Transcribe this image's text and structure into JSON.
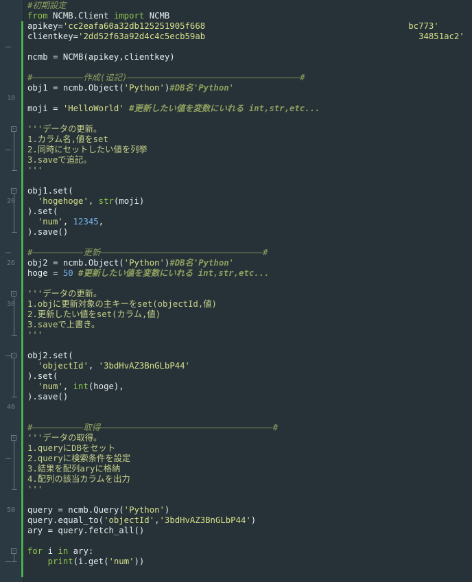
{
  "gutter": {
    "line_numbers": [
      {
        "label": "10",
        "row": 9
      },
      {
        "label": "20",
        "row": 19
      },
      {
        "label": "26",
        "row": 25
      },
      {
        "label": "30",
        "row": 29
      },
      {
        "label": "40",
        "row": 39
      },
      {
        "label": "50",
        "row": 49
      }
    ]
  },
  "code": [
    [
      {
        "t": "#初期設定",
        "c": "c"
      }
    ],
    [
      {
        "t": "from",
        "c": "k"
      },
      {
        "t": " NCMB.Client "
      },
      {
        "t": "import",
        "c": "k"
      },
      {
        "t": " NCMB"
      }
    ],
    [
      {
        "t": "apikey="
      },
      {
        "t": "'cc2eafa60a32db125251905f668",
        "c": "s"
      },
      {
        "t": "                                        ",
        "c": ""
      },
      {
        "t": "bc773'",
        "c": "s"
      }
    ],
    [
      {
        "t": "clientkey="
      },
      {
        "t": "'2dd52f63a92d4c4c5ecb59ab",
        "c": "s"
      },
      {
        "t": "                                          ",
        "c": ""
      },
      {
        "t": "34851ac2'",
        "c": "s"
      }
    ],
    [],
    [
      {
        "t": "ncmb = NCMB(apikey,clientkey)"
      }
    ],
    [],
    [
      {
        "t": "#――――――――――作成(追記)――――――――――――――――――――――――――――――――――#",
        "c": "c"
      }
    ],
    [
      {
        "t": "obj1 = ncmb.Object("
      },
      {
        "t": "'Python'",
        "c": "s"
      },
      {
        "t": ")"
      },
      {
        "t": "#DB名'Python'",
        "c": "cb"
      }
    ],
    [],
    [
      {
        "t": "moji = "
      },
      {
        "t": "'HelloWorld'",
        "c": "s"
      },
      {
        "t": " "
      },
      {
        "t": "#更新したい値を変数にいれる int,str,etc...",
        "c": "cb"
      }
    ],
    [],
    [
      {
        "t": "'''データの更新。",
        "c": "d"
      }
    ],
    [
      {
        "t": "1.カラム名,値をset",
        "c": "d"
      }
    ],
    [
      {
        "t": "2.同時にセットしたい値を列挙",
        "c": "d"
      }
    ],
    [
      {
        "t": "3.saveで追記。",
        "c": "d"
      }
    ],
    [
      {
        "t": "'''",
        "c": "d"
      }
    ],
    [],
    [
      {
        "t": "obj1.set("
      }
    ],
    [
      {
        "t": "  "
      },
      {
        "t": "'hogehoge'",
        "c": "s"
      },
      {
        "t": ", "
      },
      {
        "t": "str",
        "c": "b"
      },
      {
        "t": "(moji)"
      }
    ],
    [
      {
        "t": ").set("
      }
    ],
    [
      {
        "t": "  "
      },
      {
        "t": "'num'",
        "c": "s"
      },
      {
        "t": ", "
      },
      {
        "t": "12345",
        "c": "n"
      },
      {
        "t": ","
      }
    ],
    [
      {
        "t": ").save()"
      }
    ],
    [],
    [
      {
        "t": "#――――――――――更新――――――――――――――――――――――――――――――――#",
        "c": "c"
      }
    ],
    [
      {
        "t": "obj2 = ncmb.Object("
      },
      {
        "t": "'Python'",
        "c": "s"
      },
      {
        "t": ")"
      },
      {
        "t": "#DB名'Python'",
        "c": "cb"
      }
    ],
    [
      {
        "t": "hoge = "
      },
      {
        "t": "50",
        "c": "n"
      },
      {
        "t": " "
      },
      {
        "t": "#更新したい値を変数にいれる int,str,etc...",
        "c": "cb"
      }
    ],
    [],
    [
      {
        "t": "'''データの更新。",
        "c": "d"
      }
    ],
    [
      {
        "t": "1.objに更新対象の主キーをset(objectId,値)",
        "c": "d"
      }
    ],
    [
      {
        "t": "2.更新したい値をset(カラム,値)",
        "c": "d"
      }
    ],
    [
      {
        "t": "3.saveで上書き。",
        "c": "d"
      }
    ],
    [
      {
        "t": "'''",
        "c": "d"
      }
    ],
    [],
    [
      {
        "t": "obj2.set("
      }
    ],
    [
      {
        "t": "  "
      },
      {
        "t": "'objectId'",
        "c": "s"
      },
      {
        "t": ", "
      },
      {
        "t": "'3bdHvAZ3BnGLbP44'",
        "c": "s"
      }
    ],
    [
      {
        "t": ").set("
      }
    ],
    [
      {
        "t": "  "
      },
      {
        "t": "'num'",
        "c": "s"
      },
      {
        "t": ", "
      },
      {
        "t": "int",
        "c": "b"
      },
      {
        "t": "(hoge),"
      }
    ],
    [
      {
        "t": ").save()"
      }
    ],
    [],
    [],
    [
      {
        "t": "#――――――――――取得――――――――――――――――――――――――――――――――――#",
        "c": "c"
      }
    ],
    [
      {
        "t": "'''データの取得。",
        "c": "d"
      }
    ],
    [
      {
        "t": "1.queryにDBをセット",
        "c": "d"
      }
    ],
    [
      {
        "t": "2.queryに検索条件を設定",
        "c": "d"
      }
    ],
    [
      {
        "t": "3.結果を配列aryに格納",
        "c": "d"
      }
    ],
    [
      {
        "t": "4.配列の該当カラムを出力",
        "c": "d"
      }
    ],
    [
      {
        "t": "'''",
        "c": "d"
      }
    ],
    [],
    [
      {
        "t": "query = ncmb.Query("
      },
      {
        "t": "'Python'",
        "c": "s"
      },
      {
        "t": ")"
      }
    ],
    [
      {
        "t": "query.equal_to("
      },
      {
        "t": "'objectId'",
        "c": "s"
      },
      {
        "t": ","
      },
      {
        "t": "'3bdHvAZ3BnGLbP44'",
        "c": "s"
      },
      {
        "t": ")"
      }
    ],
    [
      {
        "t": "ary = query.fetch_all()"
      }
    ],
    [],
    [
      {
        "t": "for",
        "c": "k"
      },
      {
        "t": " i "
      },
      {
        "t": "in",
        "c": "k"
      },
      {
        "t": " ary:"
      }
    ],
    [
      {
        "t": "    "
      },
      {
        "t": "print",
        "c": "b"
      },
      {
        "t": "(i.get("
      },
      {
        "t": "'num'",
        "c": "s"
      },
      {
        "t": "))"
      }
    ]
  ]
}
